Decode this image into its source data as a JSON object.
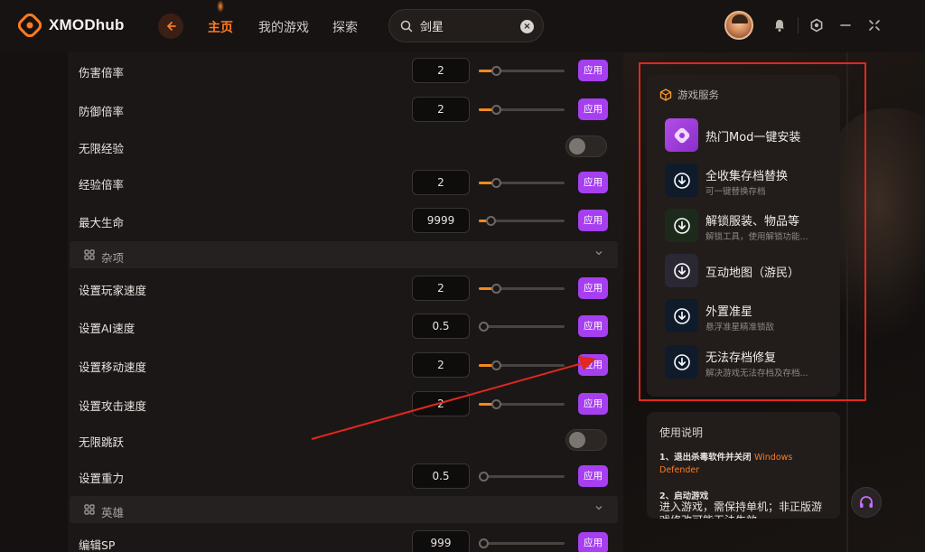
{
  "app": {
    "name": "XMODhub"
  },
  "nav": {
    "tabs": [
      {
        "label": "主页",
        "active": true
      },
      {
        "label": "我的游戏",
        "active": false
      },
      {
        "label": "探索",
        "active": false
      }
    ]
  },
  "search": {
    "value": "剑星",
    "clear_label": "×"
  },
  "settings": {
    "rows1": [
      {
        "label": "伤害倍率",
        "value": "2",
        "slider_fraction": 0.15
      },
      {
        "label": "防御倍率",
        "value": "2",
        "slider_fraction": 0.15
      }
    ],
    "toggle_exp": {
      "label": "无限经验",
      "on": false
    },
    "rows2": [
      {
        "label": "经验倍率",
        "value": "2",
        "slider_fraction": 0.15
      },
      {
        "label": "最大生命",
        "value": "9999",
        "slider_fraction": 0.08
      }
    ],
    "section_misc": {
      "label": "杂项"
    },
    "rows3": [
      {
        "label": "设置玩家速度",
        "value": "2",
        "slider_fraction": 0.15
      },
      {
        "label": "设置AI速度",
        "value": "0.5",
        "slider_fraction": 0.0
      },
      {
        "label": "设置移动速度",
        "value": "2",
        "slider_fraction": 0.15
      },
      {
        "label": "设置攻击速度",
        "value": "2",
        "slider_fraction": 0.15
      }
    ],
    "toggle_jump": {
      "label": "无限跳跃",
      "on": false
    },
    "rows4": [
      {
        "label": "设置重力",
        "value": "0.5",
        "slider_fraction": 0.0
      }
    ],
    "section_hero": {
      "label": "英雄"
    },
    "rows5": [
      {
        "label": "编辑SP",
        "value": "999",
        "slider_fraction": 0.0
      }
    ],
    "apply_label": "应用"
  },
  "services": {
    "title": "游戏服务",
    "items": [
      {
        "name": "热门Mod一键安装",
        "desc": "",
        "icon": "puzzle-icon"
      },
      {
        "name": "全收集存档替换",
        "desc": "可一键替换存档",
        "icon": "download-icon"
      },
      {
        "name": "解锁服装、物品等",
        "desc": "解锁工具，使用解锁功能...",
        "icon": "download-icon"
      },
      {
        "name": "互动地图（游民）",
        "desc": "",
        "icon": "download-icon"
      },
      {
        "name": "外置准星",
        "desc": "悬浮准星精准锁敌",
        "icon": "download-icon"
      },
      {
        "name": "无法存档修复",
        "desc": "解决游戏无法存档及存档...",
        "icon": "download-icon"
      }
    ]
  },
  "guide": {
    "title": "使用说明",
    "step1_text": "1、退出杀毒软件并关闭",
    "step1_highlight": "Windows Defender",
    "step2_title": "2、启动游戏",
    "step2_desc": "进入游戏，需保持单机；非正版游戏修改可能无法生效"
  },
  "colors": {
    "accent_orange": "#ff7a1f",
    "apply_purple": "#a63ff0",
    "annotation_red": "#e2271f"
  }
}
